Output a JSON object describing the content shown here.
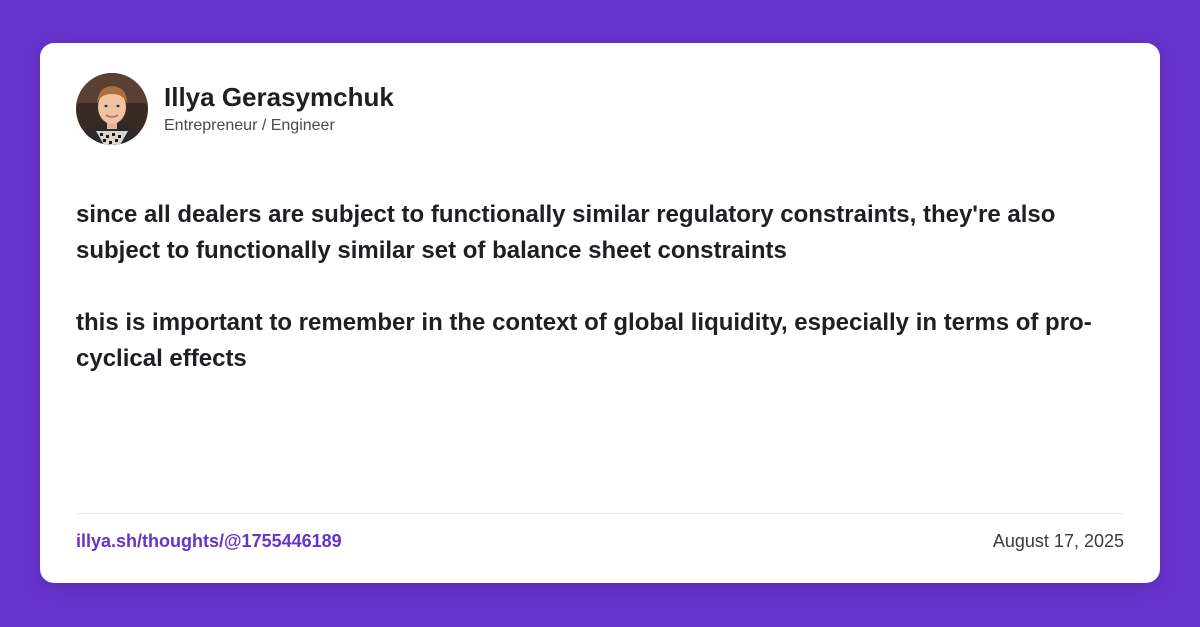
{
  "colors": {
    "background": "#6633cc",
    "card": "#ffffff",
    "accent_link": "#6633cc",
    "text_primary": "#1f1f23",
    "text_secondary": "#4a4a50"
  },
  "author": {
    "name": "Illya Gerasymchuk",
    "title": "Entrepreneur / Engineer",
    "avatar_icon": "avatar-photo"
  },
  "post": {
    "paragraphs": [
      "since all dealers are subject to functionally similar regulatory constraints, they're also subject to functionally similar set of balance sheet constraints",
      "this is important to remember in the context of global liquidity, especially in terms of pro-cyclical effects"
    ]
  },
  "footer": {
    "link_text": "illya.sh/thoughts/@1755446189",
    "date": "August 17, 2025"
  }
}
